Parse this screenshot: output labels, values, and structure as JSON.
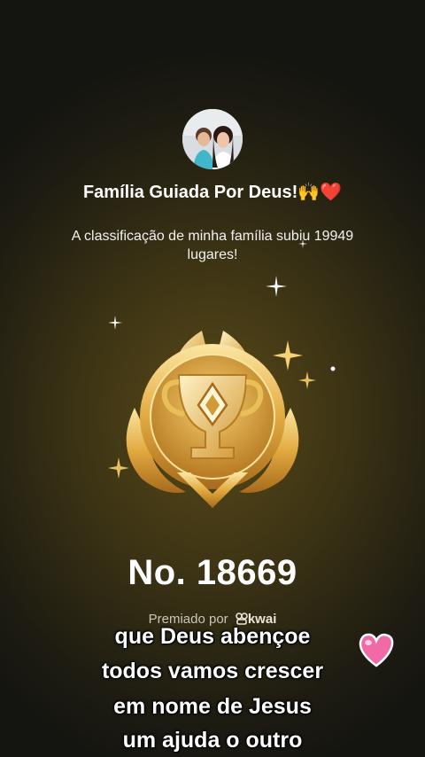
{
  "header": {
    "title": "Família Guiada Por Deus!🙌❤️",
    "subtitle": "A classificação de minha família subiu 19949 lugares!"
  },
  "award": {
    "rank": "No. 18669",
    "awarded_by": "Premiado por",
    "brand": "kwai",
    "icon": "trophy-medal"
  },
  "caption": {
    "lines": [
      "que Deus abençoe",
      "todos vamos crescer",
      "em nome de Jesus",
      "um ajuda o outro"
    ]
  },
  "colors": {
    "gold": "#e0b04a",
    "background": "#1e1c12",
    "heart": "#f06aa8"
  }
}
